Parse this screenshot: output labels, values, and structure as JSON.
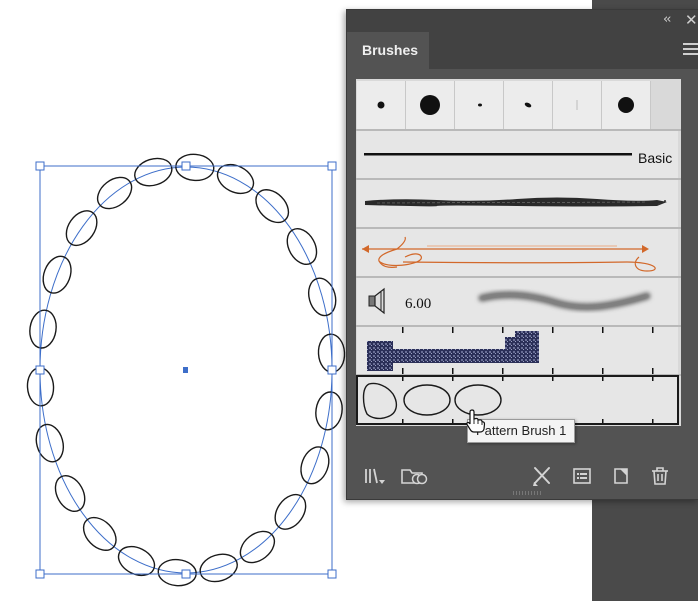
{
  "panel": {
    "tab_label": "Brushes",
    "collapse_glyph": "‹‹",
    "close_glyph": "✕",
    "menu_icon": "hamburger-menu-icon"
  },
  "brushes": {
    "calligraphic_dots": [
      "small-round",
      "large-round",
      "tiny-oval",
      "small-angled-oval",
      "thin-vertical",
      "medium-round"
    ],
    "basic_label": "Basic",
    "bristle_size": "6.00",
    "selected": "Pattern Brush 1"
  },
  "tooltip": "Pattern Brush 1",
  "bottom_toolbar": [
    {
      "name": "brush-libraries-menu-icon"
    },
    {
      "name": "libraries-panel-icon"
    },
    {
      "name": "remove-brush-stroke-icon"
    },
    {
      "name": "options-of-selected-object-icon"
    },
    {
      "name": "new-brush-icon"
    },
    {
      "name": "delete-brush-icon"
    }
  ],
  "colors": {
    "panel_bg": "#535353",
    "panel_header": "#424242",
    "selection_blue": "#3d6ec9",
    "arrow_orange": "#d2682a"
  }
}
